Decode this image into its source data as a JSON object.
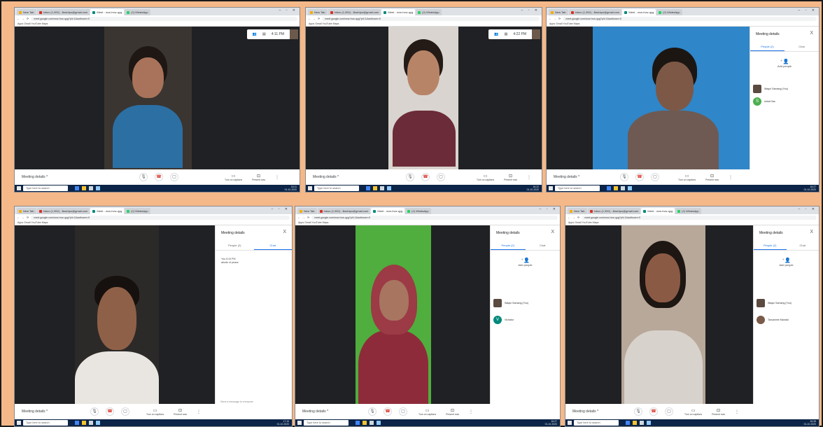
{
  "browser": {
    "tabs": [
      {
        "label": "New Tab",
        "icon": "new-tab-icon",
        "color": "#f9ab00"
      },
      {
        "label": "Inbox (1,992) - lilashipo@gmail.com",
        "icon": "gmail-icon",
        "color": "#d93025"
      },
      {
        "label": "Meet - ncw-hvw-qyg",
        "icon": "meet-icon",
        "color": "#00897b"
      },
      {
        "label": "(2) WhatsApp",
        "icon": "whatsapp-icon",
        "color": "#25d366"
      }
    ],
    "url": "meet.google.com/ncw-hvw-qyg?pli=1&authuser=0",
    "bookmarks": "Apps   Gmail   YouTube   Maps"
  },
  "meet": {
    "meeting_details": "Meeting details  ^",
    "captions_label": "Turn on captions",
    "present_label": "Present now",
    "mic_icon": "🎙",
    "hangup_icon": "☎",
    "camera_icon": "▢"
  },
  "panels": {
    "title": "Meeting details",
    "close": "X",
    "people_tab": "People (2)",
    "chat_tab": "Chat",
    "add_people": "Add people"
  },
  "shots": [
    {
      "clock": "4:11 PM"
    },
    {
      "clock": "4:22 PM"
    },
    {
      "people": [
        {
          "name": "Waqui Samang (You)"
        },
        {
          "name": "shiuk Das",
          "initial": "S"
        }
      ]
    },
    {
      "chat_meta": "You  5:15 PM",
      "chat_text": "abode of peace",
      "chat_placeholder": "Send a message to everyone"
    },
    {
      "people": [
        {
          "name": "Waqui Samang (You)"
        },
        {
          "name": "Vichatur",
          "initial": "V"
        }
      ]
    },
    {
      "people": [
        {
          "name": "Waqui Samang (You)"
        },
        {
          "name": "Tanushree Mandal"
        }
      ]
    }
  ],
  "taskbar": {
    "search_placeholder": "Type here to search",
    "times": [
      "16:11",
      "16:22",
      "16:27",
      "17:16",
      "16:27",
      "16:35"
    ],
    "date": "01-10-2020"
  }
}
